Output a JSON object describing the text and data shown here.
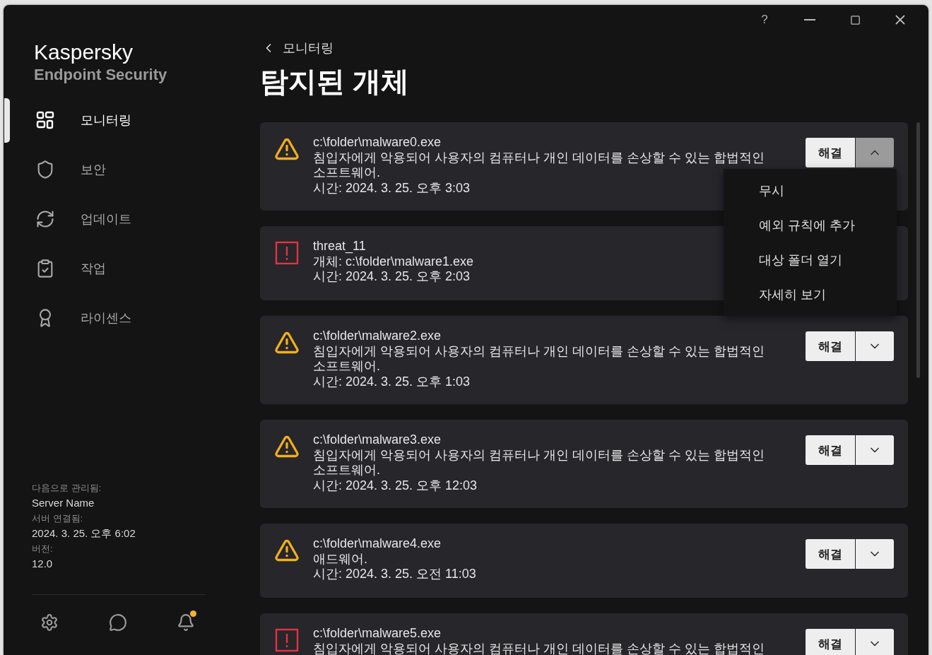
{
  "window": {
    "help": "?"
  },
  "sidebar": {
    "brand": "Kaspersky",
    "product": "Endpoint Security",
    "items": [
      {
        "label": "모니터링",
        "selected": true
      },
      {
        "label": "보안",
        "selected": false
      },
      {
        "label": "업데이트",
        "selected": false
      },
      {
        "label": "작업",
        "selected": false
      },
      {
        "label": "라이센스",
        "selected": false
      }
    ],
    "info": [
      {
        "label": "다음으로 관리됨:",
        "value": "Server Name"
      },
      {
        "label": "서버 연결됨:",
        "value": "2024. 3. 25. 오후 6:02"
      },
      {
        "label": "버전:",
        "value": "12.0"
      }
    ],
    "footer": {
      "notification_badge": true
    }
  },
  "breadcrumb": "모니터링",
  "title": "탐지된 개체",
  "detections": [
    {
      "kind": "warning",
      "name": "c:\\folder\\malware0.exe",
      "description": "침입자에게 악용되어 사용자의 컴퓨터나 개인 데이터를 손상할 수 있는 합법적인 소프트웨어.",
      "time": "시간: 2024. 3. 25. 오후 3:03",
      "action": "해결",
      "expanded": true,
      "menu": [
        "무시",
        "예외 규칙에 추가",
        "대상 폴더 열기",
        "자세히 보기"
      ]
    },
    {
      "kind": "threat",
      "name": "threat_11",
      "description": "개체: c:\\folder\\malware1.exe",
      "time": "시간: 2024. 3. 25. 오후 2:03"
    },
    {
      "kind": "warning",
      "name": "c:\\folder\\malware2.exe",
      "description": "침입자에게 악용되어 사용자의 컴퓨터나 개인 데이터를 손상할 수 있는 합법적인 소프트웨어.",
      "time": "시간: 2024. 3. 25. 오후 1:03",
      "action": "해결",
      "expanded": false
    },
    {
      "kind": "warning",
      "name": "c:\\folder\\malware3.exe",
      "description": "침입자에게 악용되어 사용자의 컴퓨터나 개인 데이터를 손상할 수 있는 합법적인 소프트웨어.",
      "time": "시간: 2024. 3. 25. 오후 12:03",
      "action": "해결",
      "expanded": false
    },
    {
      "kind": "warning",
      "name": "c:\\folder\\malware4.exe",
      "description": "애드웨어.",
      "time": "시간: 2024. 3. 25. 오전 11:03",
      "action": "해결",
      "expanded": false
    },
    {
      "kind": "threat",
      "name": "c:\\folder\\malware5.exe",
      "description": "침입자에게 악용되어 사용자의 컴퓨터나 개인 데이터를 손상할 수 있는 합법적인",
      "action": "해결",
      "expanded": false
    }
  ]
}
